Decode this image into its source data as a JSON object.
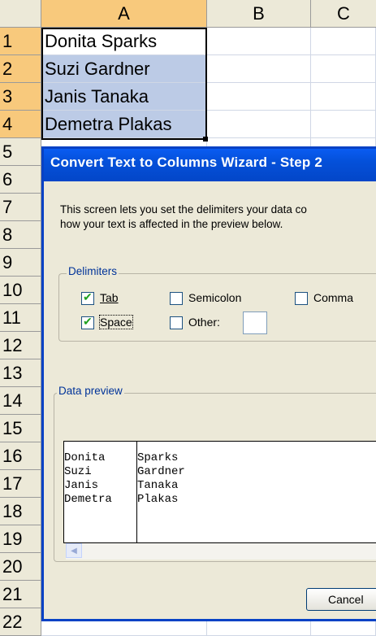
{
  "spreadsheet": {
    "columns": [
      "A",
      "B",
      "C"
    ],
    "rows": [
      "1",
      "2",
      "3",
      "4",
      "5",
      "6",
      "7",
      "8",
      "9",
      "10",
      "11",
      "12",
      "13",
      "14",
      "15",
      "16",
      "17",
      "18",
      "19",
      "20",
      "21",
      "22"
    ],
    "cells_col_a": [
      "Donita Sparks",
      "Suzi Gardner",
      "Janis Tanaka",
      "Demetra Plakas"
    ]
  },
  "dialog": {
    "title": "Convert Text to Columns Wizard - Step 2",
    "description_line1": "This screen lets you set the delimiters your data co",
    "description_line2": "how your text is affected in the preview below.",
    "delimiters_label": "Delimiters",
    "delimiters": {
      "tab": {
        "label": "Tab",
        "checked": true
      },
      "semicolon": {
        "label": "Semicolon",
        "checked": false
      },
      "comma": {
        "label": "Comma",
        "checked": false
      },
      "space": {
        "label": "Space",
        "checked": true
      },
      "other": {
        "label": "Other:",
        "checked": false,
        "value": ""
      }
    },
    "preview_label": "Data preview",
    "preview_col1": [
      "Donita",
      "Suzi",
      "Janis",
      "Demetra"
    ],
    "preview_col2": [
      "Sparks",
      "Gardner",
      "Tanaka",
      "Plakas"
    ],
    "cancel_label": "Cancel"
  }
}
